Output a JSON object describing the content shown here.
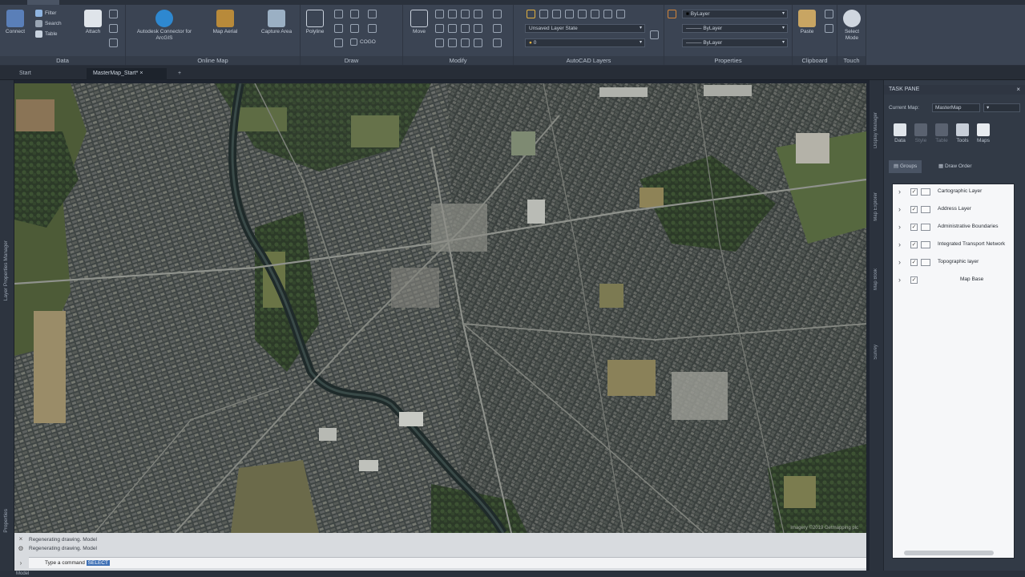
{
  "ribbon": {
    "panels": [
      {
        "title": "Data",
        "big_button": "Attach",
        "first_button": "Connect",
        "small": [
          "Filter",
          "Search",
          "Table"
        ]
      },
      {
        "title": "Online Map",
        "buttons": [
          "Autodesk Connector for ArcGIS",
          "Map Aerial",
          "Capture Area"
        ]
      },
      {
        "title": "Draw",
        "big_button": "Polyline",
        "small": [
          "COGO"
        ]
      },
      {
        "title": "Modify",
        "big_button": "Move"
      },
      {
        "title": "AutoCAD Layers",
        "combo_style": "Unsaved Layer State",
        "combo_layer": "0"
      },
      {
        "title": "Properties",
        "combos": [
          "ByLayer",
          "ByLayer",
          "ByLayer"
        ]
      },
      {
        "title": "Clipboard",
        "big_button": "Paste"
      },
      {
        "title": "Touch",
        "big_button": "Select Mode"
      }
    ]
  },
  "doc_tabs": [
    {
      "label": "Start"
    },
    {
      "label": "MasterMap_Start*",
      "close": "×"
    },
    {
      "label": "+"
    }
  ],
  "left_strip": {
    "labels": [
      "Layer Properties Manager",
      "Properties"
    ]
  },
  "map": {
    "attribution": "Imagery ©2019 Getmapping plc"
  },
  "command": {
    "history": [
      "Regenerating drawing.  Model",
      "Regenerating drawing.  Model"
    ],
    "prompt": "Type a command",
    "input_selected": "SELECT"
  },
  "status": {
    "tabs": [
      "Model"
    ]
  },
  "palette": {
    "title": "TASK PANE",
    "close": "×",
    "vertical_tabs": [
      "Display Manager",
      "Map Explorer",
      "Map Book",
      "Survey"
    ],
    "display_label": "Current Map:",
    "map_combo": "MasterMap",
    "tools": [
      {
        "label": "Data",
        "dim": false
      },
      {
        "label": "Style",
        "dim": true
      },
      {
        "label": "Table",
        "dim": true
      },
      {
        "label": "Tools",
        "dim": false
      },
      {
        "label": "Maps",
        "dim": false
      }
    ],
    "tabs": [
      {
        "label": "Groups",
        "active": true
      },
      {
        "label": "Draw Order",
        "active": false
      }
    ],
    "layers": [
      {
        "name": "Cartographic Layer"
      },
      {
        "name": "Address Layer"
      },
      {
        "name": "Administrative Boundaries"
      },
      {
        "name": "Integrated Transport Network"
      },
      {
        "name": "Topographic layer"
      },
      {
        "name": "Map Base"
      }
    ]
  }
}
